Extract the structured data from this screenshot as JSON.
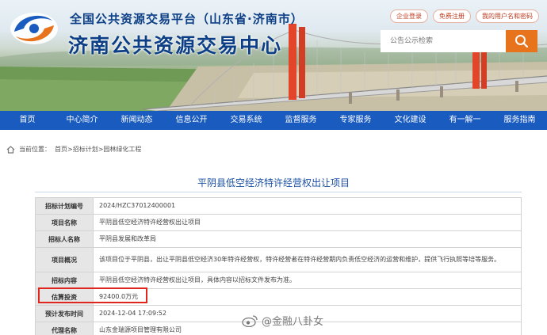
{
  "header": {
    "title_small": "全国公共资源交易平台（山东省·济南市）",
    "title_big": "济南公共资源交易中心",
    "top_links": [
      "企业登录",
      "免费注册",
      "我的用户名和密码"
    ],
    "search_placeholder": "公告公示检索"
  },
  "nav": {
    "items": [
      "首页",
      "中心简介",
      "新闻动态",
      "信息公开",
      "交易系统",
      "监督服务",
      "专家服务",
      "文化建设",
      "有一解一",
      "服务指南"
    ]
  },
  "breadcrumb": {
    "prefix": "当前位置：",
    "path": "首页>招标计划>园林绿化工程"
  },
  "project": {
    "title": "平阴县低空经济特许经营权出让项目",
    "rows": [
      {
        "label": "招标计划编号",
        "value": "2024/HZC37012400001"
      },
      {
        "label": "项目名称",
        "value": "平阴县低空经济特许经营权出让项目"
      },
      {
        "label": "招标人名称",
        "value": "平阴县发展和改革局"
      },
      {
        "label": "项目概况",
        "value": "该项目位于平阴县，出让平阴县低空经济30年特许经营权，特许经营者在特许经营期内负责低空经济的运营和维护，提供飞行执照等培等服务。"
      },
      {
        "label": "招标内容",
        "value": "平阴县低空经济特许经营权出让项目，具体内容以招标文件发布为准。"
      },
      {
        "label": "估算投资",
        "value": "92400.0万元"
      },
      {
        "label": "预计发布时间",
        "value": "2024-12-04 17:09:52"
      },
      {
        "label": "代理名称",
        "value": "山东金瑞源项目管理有限公司"
      }
    ]
  },
  "watermark": {
    "text": "@金融八卦女"
  },
  "colors": {
    "nav_bg": "#1a5bc0",
    "title_blue": "#0d3f86",
    "search_button": "#e8731d",
    "highlight_red": "#e0251d"
  },
  "icons": {
    "search": "magnifier-icon",
    "home": "home-icon",
    "logo": "swirl-logo-icon",
    "watermark": "weibo-icon"
  }
}
